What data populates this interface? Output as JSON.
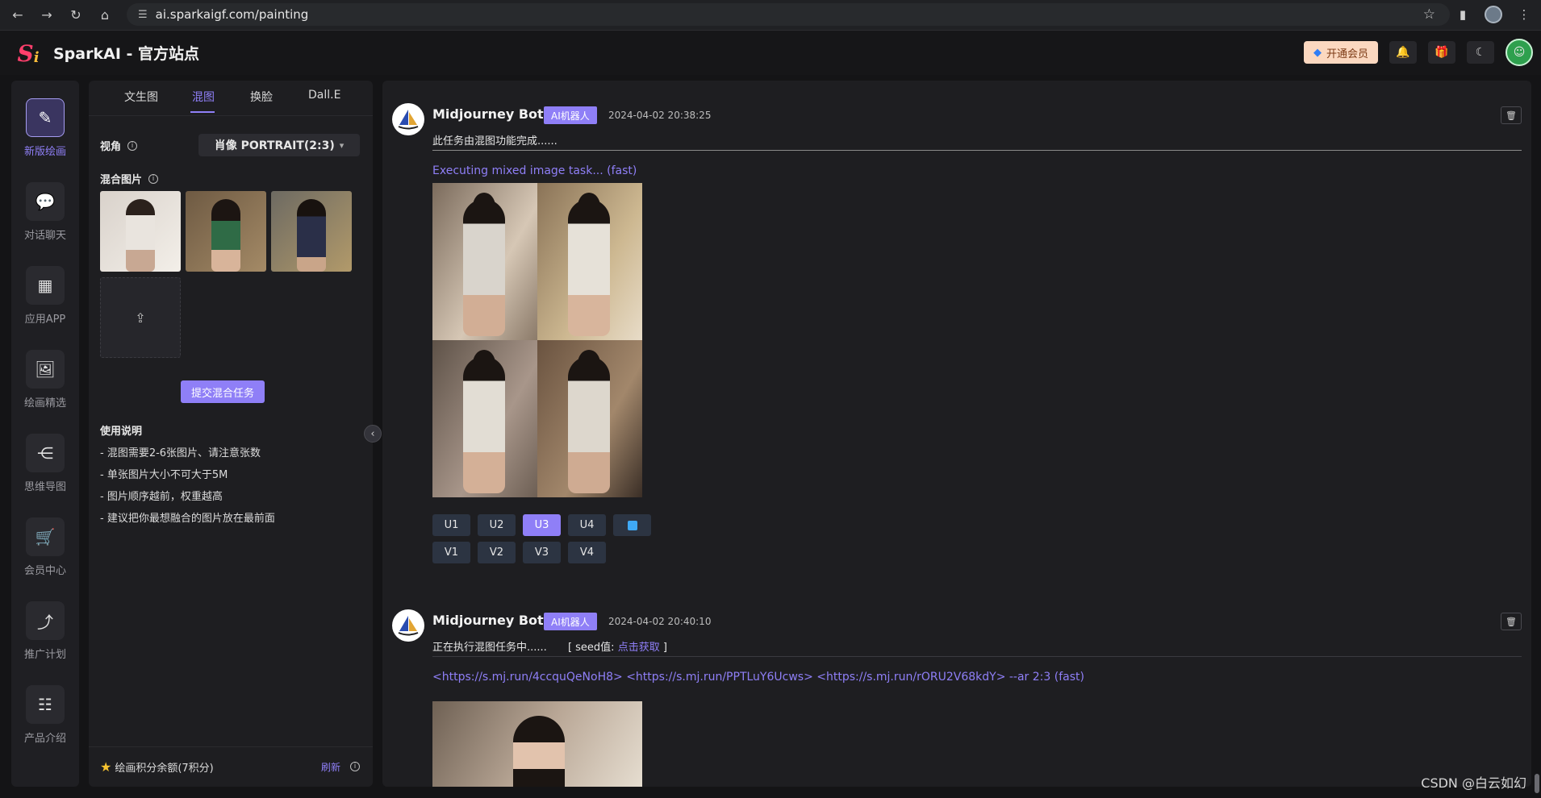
{
  "browser": {
    "url": "ai.sparkaigf.com/painting"
  },
  "header": {
    "title": "SparkAI - 官方站点",
    "vip_label": "开通会员"
  },
  "nav": {
    "items": [
      {
        "label": "新版绘画",
        "icon": "paint-brush-icon",
        "active": true
      },
      {
        "label": "对话聊天",
        "icon": "chat-bubble-icon"
      },
      {
        "label": "应用APP",
        "icon": "apps-grid-icon"
      },
      {
        "label": "绘画精选",
        "icon": "gallery-icon"
      },
      {
        "label": "思维导图",
        "icon": "mindmap-icon"
      },
      {
        "label": "会员中心",
        "icon": "cart-icon"
      },
      {
        "label": "推广计划",
        "icon": "share-icon"
      },
      {
        "label": "产品介绍",
        "icon": "product-icon"
      }
    ]
  },
  "panel": {
    "tabs": [
      {
        "label": "文生图"
      },
      {
        "label": "混图",
        "active": true
      },
      {
        "label": "换脸"
      },
      {
        "label": "Dall.E"
      }
    ],
    "view_label": "视角",
    "view_value": "肖像 PORTRAIT(2:3)",
    "blend_label": "混合图片",
    "submit_label": "提交混合任务",
    "instructions_title": "使用说明",
    "instructions": [
      "- 混图需要2-6张图片、请注意张数",
      "- 单张图片大小不可大于5M",
      "- 图片顺序越前，权重越高",
      "- 建议把你最想融合的图片放在最前面"
    ],
    "credits_text": "绘画积分余额(7积分)",
    "refresh_label": "刷新"
  },
  "messages": [
    {
      "bot_name": "Midjourney Bot",
      "badge": "AI机器人",
      "time": "2024-04-02 20:38:25",
      "text": "此任务由混图功能完成......",
      "prompt": "Executing mixed image task... (fast)",
      "u_buttons": [
        "U1",
        "U2",
        "U3",
        "U4"
      ],
      "v_buttons": [
        "V1",
        "V2",
        "V3",
        "V4"
      ],
      "active_button": "U3"
    },
    {
      "bot_name": "Midjourney Bot",
      "badge": "AI机器人",
      "time": "2024-04-02 20:40:10",
      "text": "正在执行混图任务中......",
      "seed_prefix": "[ seed值:",
      "seed_link": "点击获取",
      "seed_suffix": "]",
      "prompt": "<https://s.mj.run/4ccquQeNoH8> <https://s.mj.run/PPTLuY6Ucws> <https://s.mj.run/rORU2V68kdY> --ar 2:3 (fast)"
    }
  ],
  "watermark": "CSDN @白云如幻",
  "colors": {
    "accent": "#8f7ff7",
    "background": "#141416",
    "panel": "#1e1e21"
  }
}
